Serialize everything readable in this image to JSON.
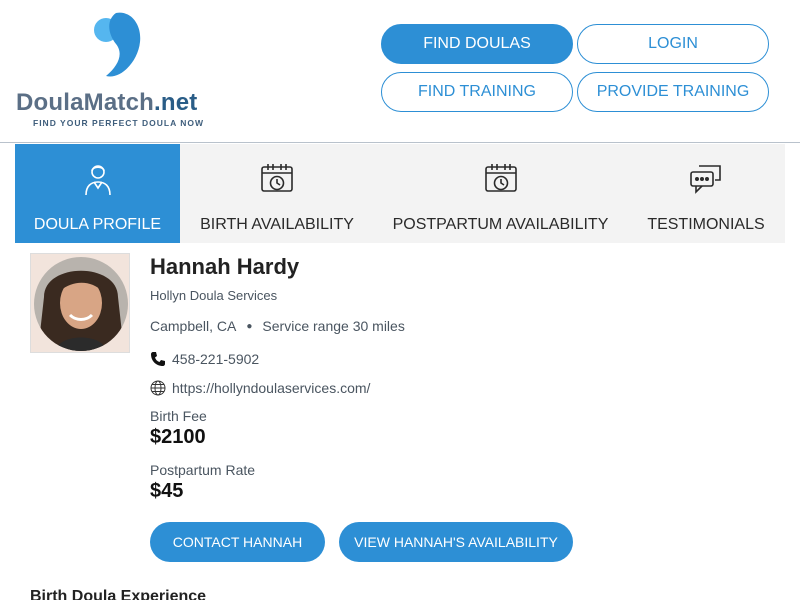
{
  "logo": {
    "brand_main": "DoulaMatch",
    "brand_suffix": ".net",
    "tagline": "FIND YOUR PERFECT DOULA NOW"
  },
  "nav": {
    "find_doulas": "FIND DOULAS",
    "login": "LOGIN",
    "find_training": "FIND TRAINING",
    "provide_training": "PROVIDE TRAINING"
  },
  "tabs": [
    {
      "label": "DOULA PROFILE",
      "icon": "user-icon",
      "active": true
    },
    {
      "label": "BIRTH AVAILABILITY",
      "icon": "calendar-clock-icon",
      "active": false
    },
    {
      "label": "POSTPARTUM AVAILABILITY",
      "icon": "calendar-clock-icon",
      "active": false
    },
    {
      "label": "TESTIMONIALS",
      "icon": "chat-bubbles-icon",
      "active": false
    }
  ],
  "profile": {
    "name": "Hannah Hardy",
    "business": "Hollyn Doula Services",
    "city": "Campbell, CA",
    "service_range": "Service range 30 miles",
    "phone": "458-221-5902",
    "website": "https://hollyndoulaservices.com/",
    "birth_fee_label": "Birth Fee",
    "birth_fee": "$2100",
    "postpartum_rate_label": "Postpartum Rate",
    "postpartum_rate": "$45"
  },
  "actions": {
    "contact": "CONTACT HANNAH",
    "availability": "VIEW HANNAH'S AVAILABILITY"
  },
  "sections": {
    "experience_heading": "Birth Doula Experience"
  },
  "colors": {
    "accent": "#2d8fd5",
    "tab_bg": "#f3f3f3"
  }
}
